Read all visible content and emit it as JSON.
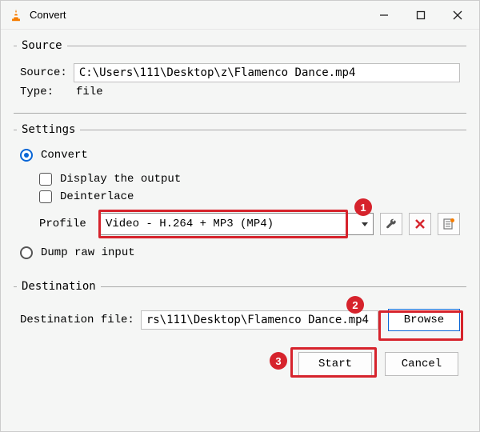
{
  "window": {
    "title": "Convert"
  },
  "source": {
    "legend": "Source",
    "source_label": "Source:",
    "source_value": "C:\\Users\\111\\Desktop\\z\\Flamenco Dance.mp4",
    "type_label": "Type:",
    "type_value": "file"
  },
  "settings": {
    "legend": "Settings",
    "convert_label": "Convert",
    "display_output_label": "Display the output",
    "deinterlace_label": "Deinterlace",
    "profile_label": "Profile",
    "profile_value": "Video - H.264 + MP3 (MP4)",
    "dump_raw_label": "Dump raw input"
  },
  "destination": {
    "legend": "Destination",
    "dest_label": "Destination file:",
    "dest_value": "rs\\111\\Desktop\\Flamenco Dance.mp4",
    "browse_label": "Browse"
  },
  "actions": {
    "start_label": "Start",
    "cancel_label": "Cancel"
  },
  "annotations": {
    "badge1": "1",
    "badge2": "2",
    "badge3": "3"
  },
  "icons": {
    "wrench": "wrench-icon",
    "delete": "delete-icon",
    "list": "list-icon"
  }
}
